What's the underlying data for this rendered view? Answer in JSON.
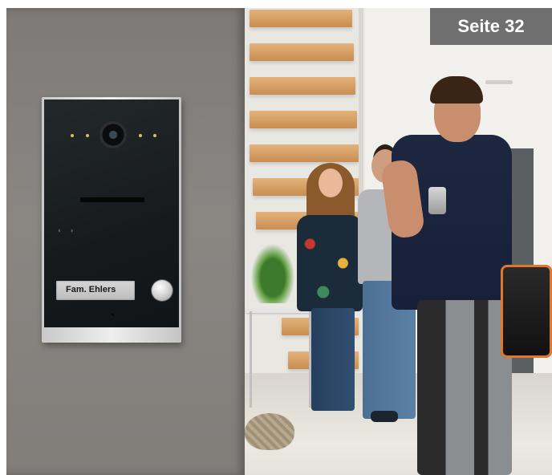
{
  "badge": {
    "label": "Seite 32"
  },
  "door_station": {
    "name_plate": "Fam. Ehlers"
  },
  "colors": {
    "badge_bg": "#6f6f6f",
    "badge_text": "#ffffff",
    "station_face": "#161a1c",
    "step_wood": "#d49a5e"
  }
}
